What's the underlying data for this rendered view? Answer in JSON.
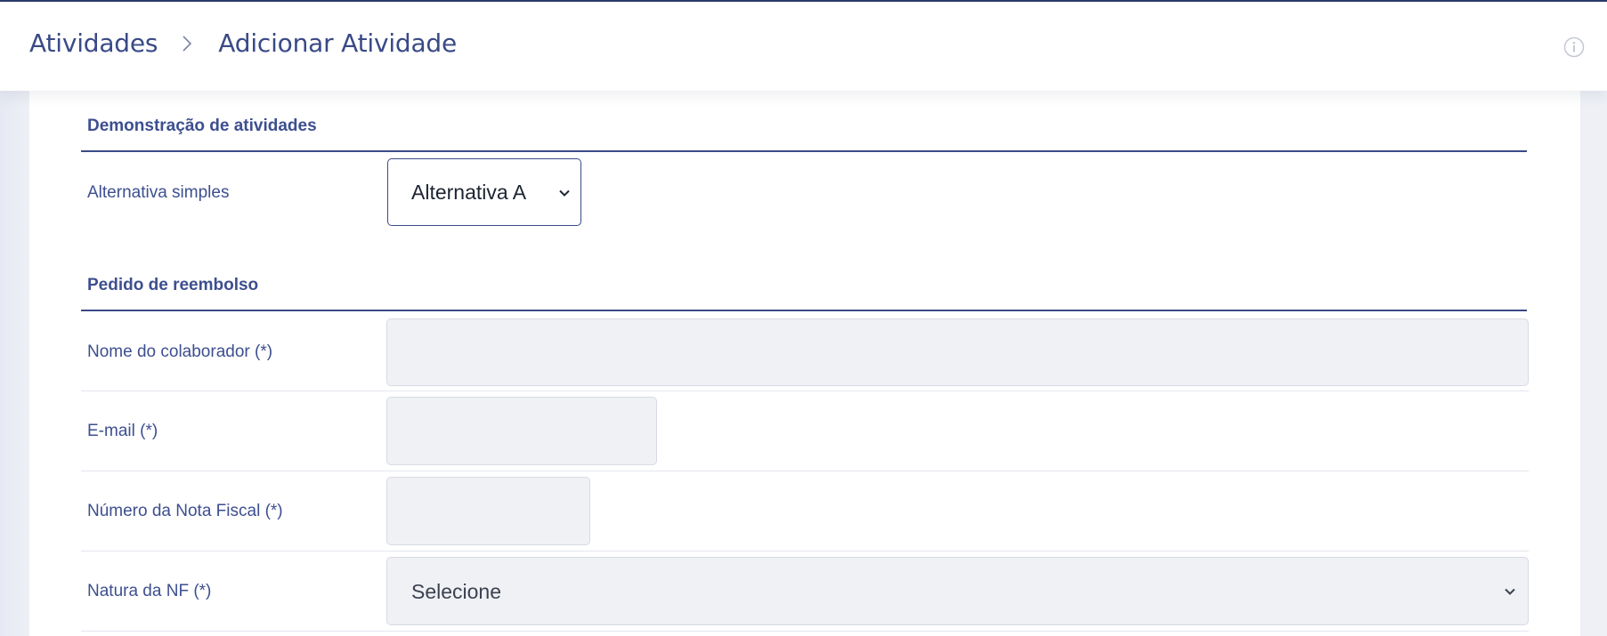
{
  "header": {
    "breadcrumb_root": "Atividades",
    "breadcrumb_current": "Adicionar Atividade",
    "icons": {
      "separator": "chevron-right-icon",
      "info": "info-icon"
    }
  },
  "sections": {
    "demo": {
      "title": "Demonstração de atividades",
      "simple_choice_label": "Alternativa simples",
      "simple_choice_value": "Alternativa A"
    },
    "refund": {
      "title": "Pedido de reembolso",
      "employee_name_label": "Nome do colaborador (*)",
      "employee_name_value": "",
      "email_label": "E-mail (*)",
      "email_value": "",
      "invoice_number_label": "Número da Nota Fiscal (*)",
      "invoice_number_value": "",
      "invoice_nature_label": "Natura da NF (*)",
      "invoice_nature_value": "Selecione"
    }
  },
  "colors": {
    "accent": "#3a4a86",
    "label": "#3d4f8f",
    "field_bg": "#f0f1f5",
    "field_border": "#d7dae3",
    "page_bg": "#eef0f6"
  }
}
